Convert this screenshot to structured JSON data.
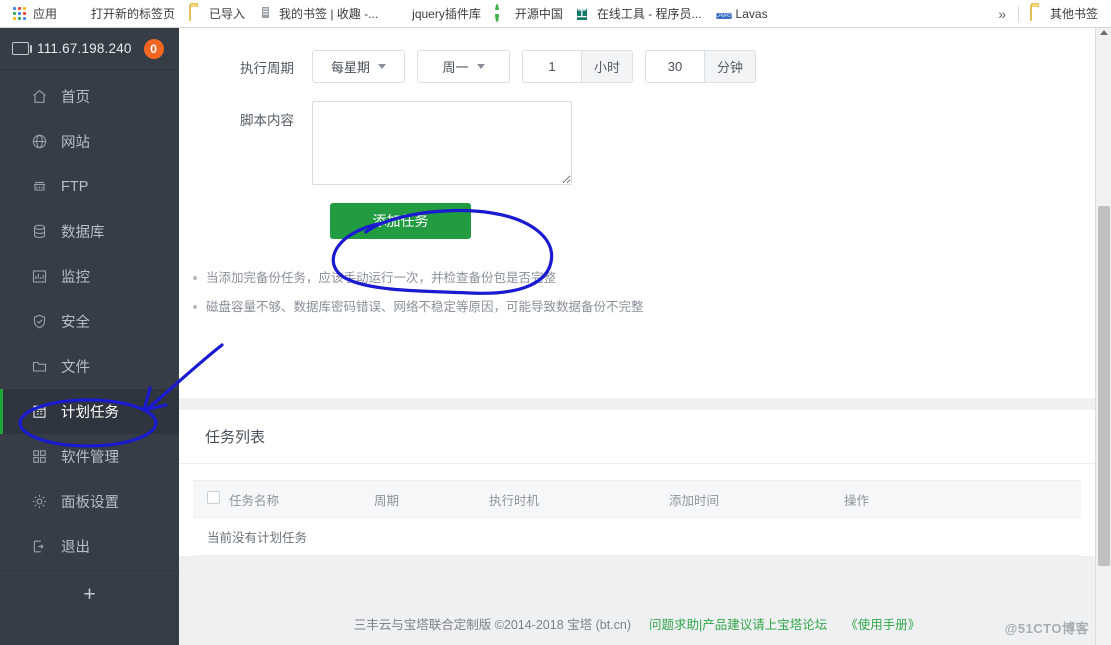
{
  "browser": {
    "bookmarks": [
      {
        "label": "应用",
        "icon": "apps-grid-icon"
      },
      {
        "label": "打开新的标签页",
        "icon": "globe-icon"
      },
      {
        "label": "已导入",
        "icon": "folder-icon"
      },
      {
        "label": "我的书签 | 收趣 -...",
        "icon": "bookmark-icon"
      },
      {
        "label": "jquery插件库",
        "icon": "jquery-icon"
      },
      {
        "label": "开源中国",
        "icon": "oschina-icon"
      },
      {
        "label": "在线工具 - 程序员...",
        "icon": "tool-icon"
      },
      {
        "label": "Lavas",
        "icon": "lavas-icon"
      }
    ],
    "overflow_label": "»",
    "other_bookmarks": {
      "label": "其他书签",
      "icon": "folder-icon"
    }
  },
  "sidebar": {
    "ip": "111.67.198.240",
    "badge": "0",
    "items": [
      {
        "label": "首页",
        "icon": "home-icon",
        "active": false
      },
      {
        "label": "网站",
        "icon": "globe-icon",
        "active": false
      },
      {
        "label": "FTP",
        "icon": "ftp-icon",
        "active": false
      },
      {
        "label": "数据库",
        "icon": "database-icon",
        "active": false
      },
      {
        "label": "监控",
        "icon": "monitor-chart-icon",
        "active": false
      },
      {
        "label": "安全",
        "icon": "shield-icon",
        "active": false
      },
      {
        "label": "文件",
        "icon": "folder-icon",
        "active": false
      },
      {
        "label": "计划任务",
        "icon": "calendar-icon",
        "active": true
      },
      {
        "label": "软件管理",
        "icon": "apps-icon",
        "active": false
      },
      {
        "label": "面板设置",
        "icon": "gear-icon",
        "active": false
      },
      {
        "label": "退出",
        "icon": "logout-icon",
        "active": false
      }
    ],
    "add_label": "+"
  },
  "form": {
    "cycle_label": "执行周期",
    "cycle_select": "每星期",
    "weekday_select": "周一",
    "hour_value": "1",
    "hour_addon": "小时",
    "minute_value": "30",
    "minute_addon": "分钟",
    "script_label": "脚本内容",
    "script_value": "",
    "script_placeholder": "",
    "submit_label": "添加任务"
  },
  "hints": [
    "当添加完备份任务，应该手动运行一次，并检查备份包是否完整",
    "磁盘容量不够、数据库密码错误、网络不稳定等原因，可能导致数据备份不完整"
  ],
  "task_list": {
    "title": "任务列表",
    "columns": [
      "任务名称",
      "周期",
      "执行时机",
      "添加时间",
      "操作"
    ],
    "empty_text": "当前没有计划任务",
    "rows": []
  },
  "footer": {
    "copyright": "三丰云与宝塔联合定制版 ©2014-2018 宝塔 (bt.cn)",
    "forum_link": "问题求助|产品建议请上宝塔论坛",
    "manual_link": "《使用手册》"
  },
  "watermark": "@51CTO博客",
  "colors": {
    "sidebar_bg": "#363d47",
    "accent_green": "#239b41",
    "badge_orange": "#f26722",
    "link_green": "#32a54a",
    "annotation_blue": "#1a1ad0"
  }
}
